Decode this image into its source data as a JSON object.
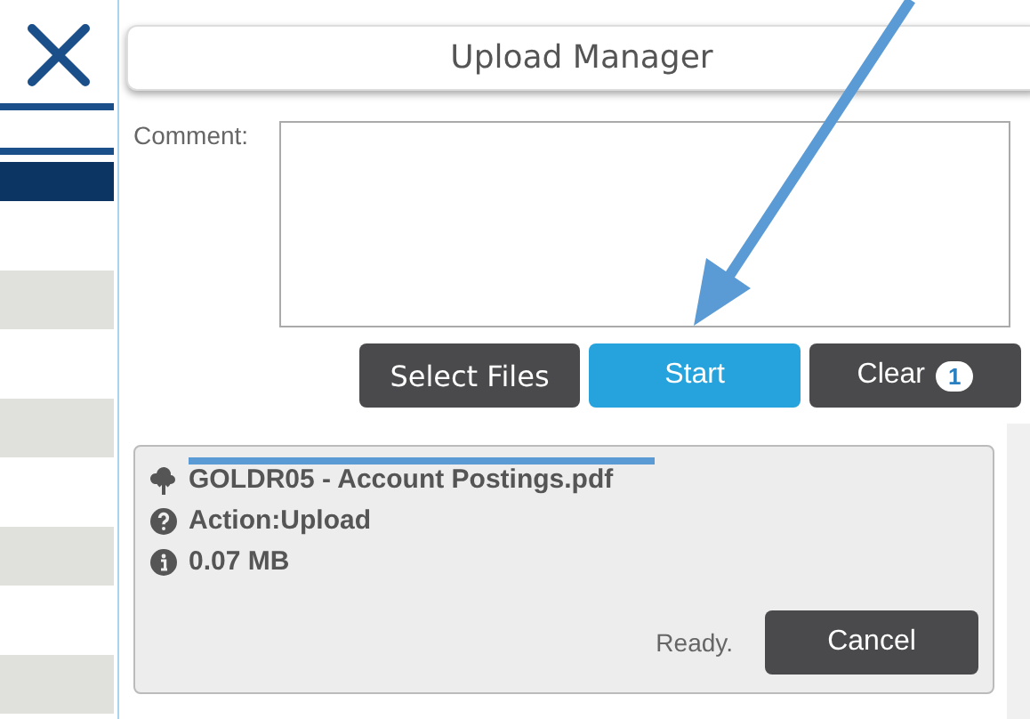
{
  "dialog": {
    "title": "Upload Manager",
    "comment_label": "Comment:"
  },
  "buttons": [
    {
      "label": "Select Files",
      "kind": "dark"
    },
    {
      "label": "Start",
      "kind": "primary"
    },
    {
      "label": "Clear",
      "kind": "dark",
      "badge": "1"
    }
  ],
  "upload_item": {
    "file_name": "GOLDR05 - Account Postings.pdf",
    "action": "Action:Upload",
    "size": "0.07 MB",
    "status": "Ready.",
    "cancel_label": "Cancel"
  }
}
